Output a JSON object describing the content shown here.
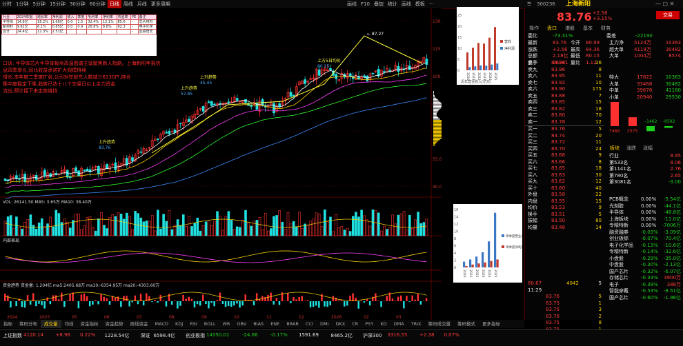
{
  "toolbar": {
    "timeframes": [
      "分时",
      "1分钟",
      "5分钟",
      "15分钟",
      "30分钟",
      "60分钟",
      "日线",
      "周线",
      "月线",
      "更多周期"
    ],
    "active_index": 6,
    "tools": [
      "画线",
      "F10",
      "叠加",
      "统计",
      "画线",
      "模板",
      "···"
    ]
  },
  "stock": {
    "code": "300236",
    "name": "上海新阳",
    "price": "83.76",
    "change": "+2.56",
    "pct": "+3.15%",
    "trade_btn": "交易"
  },
  "chart": {
    "ma_header": "MA5 MA10 MA20 MA60 ...",
    "price_labels": [
      "130.00",
      "115.00",
      "100.00",
      "85.00",
      "70.00",
      "55.00",
      "40.00"
    ],
    "peak_label": "87.27",
    "date_labels": [
      "2024",
      "2025",
      "05",
      "06",
      "07",
      "08",
      "09",
      "10",
      "11",
      "12",
      "2026",
      "02",
      "03"
    ],
    "vol_header": "VOL: 26141.50  MA5: 3.65万  MA10: 38.40万",
    "macd_header": "内部表现",
    "fund_header": "资金趋势  资金量: 1.204亿  ma5:2405.68万  ma10:-6354.95万  ma20:-4303.60万",
    "annotations": [
      "口诀: 半导体芯片半导体板块高温图谱主营聚焦新人指路。上海新阳年报信息四季增长,同比收益承诺扩大规模持续",
      "增长,本年度二季度扩张,公司对在股东人数减少6130户,持仓",
      "集中度稳定下降,趋势已达十八个交易日以上主力资金",
      "流出,预计接下来走势维持"
    ],
    "text_notes": [
      "上升趋势",
      "83.76",
      "上升趋势",
      "57.85",
      "上升趋势",
      "45.45",
      "上方5日均价",
      "80.15"
    ]
  },
  "info_table": {
    "rows": [
      [
        "行业",
        "2024年报",
        "增长率",
        "净利润",
        "收入",
        "季度",
        "毛利率",
        "净利率",
        "市盈率",
        "PE",
        "备注"
      ],
      [
        "半导体",
        "14.8亿",
        "18.2%",
        "1.66亿",
        "0.0",
        "1.5",
        "32.4%",
        "12.1%",
        "85.6",
        "-",
        "芯片材料"
      ],
      [
        "新材料",
        "9.62亿",
        "6.1%",
        "0.85亿",
        "0.0",
        "0.9",
        "28.8%",
        "8.8%",
        "62.3",
        "-",
        "电子化学"
      ],
      [
        "合计",
        "24.4亿",
        "12.3%",
        "2.51亿",
        "",
        "",
        "",
        "",
        "",
        "-",
        "业绩增长"
      ]
    ]
  },
  "mini_chart1": {
    "title": "近年营业收入(亿元)",
    "years": [
      "2020",
      "2021",
      "2022",
      "2023",
      "2024",
      "2025"
    ],
    "series": [
      {
        "name": "营收",
        "color": "#c0392b",
        "values": [
          8.1,
          10.2,
          12.4,
          12.1,
          14.8,
          19.6
        ]
      },
      {
        "name": "净利润",
        "color": "#3a78c3",
        "values": [
          1.5,
          1.8,
          2.2,
          2.1,
          2.6,
          3.1
        ]
      }
    ],
    "yticks": [
      "25",
      "20",
      "15",
      "10",
      "5",
      "0"
    ]
  },
  "mini_chart2": {
    "years": [
      "2020",
      "2021",
      "2022",
      "2023",
      "2024",
      "2025"
    ],
    "series": [
      {
        "name": "单季度营业收入(亿元)",
        "color": "#3a78c3",
        "values": [
          1.6,
          2.2,
          3.0,
          4.2,
          7.2,
          15.1
        ]
      },
      {
        "name": "单季度净利润(万元)",
        "color": "#c0392b",
        "values": [
          0.4,
          0.8,
          1.1,
          1.4,
          1.8,
          2.2
        ]
      }
    ],
    "yticks": [
      "16",
      "14",
      "12",
      "10",
      "8",
      "6",
      "4",
      "2",
      "0"
    ]
  },
  "right_panel": {
    "tabs": [
      "操作",
      "盘口",
      "港股",
      "基本",
      "财务"
    ],
    "header_row": [
      "委比",
      "-73.31%",
      "委差",
      "-22190"
    ],
    "summary": [
      {
        "l": "最新",
        "v": "83.76",
        "l2": "今开",
        "v2": "80.99"
      },
      {
        "l": "涨跌",
        "v": "+2.56",
        "l2": "最高",
        "v2": "84.36"
      },
      {
        "l": "总额",
        "v": "2.18亿",
        "l2": "最低",
        "v2": "80.15"
      },
      {
        "l": "总手",
        "v": "26241",
        "l2": "量比",
        "v2": "1.12"
      }
    ],
    "order_book": [
      {
        "l": "卖十",
        "p": "83.98",
        "q": "26"
      },
      {
        "l": "卖九",
        "p": "83.96",
        "q": "8"
      },
      {
        "l": "卖八",
        "p": "83.95",
        "q": "11"
      },
      {
        "l": "卖七",
        "p": "83.92",
        "q": "10"
      },
      {
        "l": "卖六",
        "p": "83.90",
        "q": "175"
      },
      {
        "l": "卖五",
        "p": "83.88",
        "q": "7"
      },
      {
        "l": "卖四",
        "p": "83.85",
        "q": "15"
      },
      {
        "l": "卖三",
        "p": "83.82",
        "q": "18"
      },
      {
        "l": "卖二",
        "p": "83.80",
        "q": "70"
      },
      {
        "l": "卖一",
        "p": "83.78",
        "q": "12"
      },
      {
        "l": "买一",
        "p": "83.76",
        "q": "5"
      },
      {
        "l": "买二",
        "p": "83.74",
        "q": "20"
      },
      {
        "l": "买三",
        "p": "83.72",
        "q": "11"
      },
      {
        "l": "买四",
        "p": "83.70",
        "q": "24"
      },
      {
        "l": "买五",
        "p": "83.68",
        "q": "9"
      },
      {
        "l": "买六",
        "p": "83.66",
        "q": "8"
      },
      {
        "l": "买七",
        "p": "83.65",
        "q": "18"
      },
      {
        "l": "买八",
        "p": "83.63",
        "q": "30"
      },
      {
        "l": "买九",
        "p": "83.62",
        "q": "12"
      },
      {
        "l": "买十",
        "p": "83.60",
        "q": "40"
      },
      {
        "l": "外盘",
        "p": "83.58",
        "q": "22"
      },
      {
        "l": "内盘",
        "p": "83.55",
        "q": "15"
      },
      {
        "l": "均价",
        "p": "83.53",
        "q": "9"
      },
      {
        "l": "换手",
        "p": "83.51",
        "q": "5"
      },
      {
        "l": "振幅",
        "p": "83.50",
        "q": "80"
      },
      {
        "l": "均量",
        "p": "83.48",
        "q": "14"
      }
    ],
    "fund_flow": [
      {
        "l": "主力净",
        "v": "5124万",
        "v2": "10363"
      },
      {
        "l": "超大单",
        "v": "4119万",
        "v2": "30482"
      },
      {
        "l": "大单",
        "v": "1004万",
        "v2": "8574"
      }
    ],
    "flow_table": [
      {
        "l": "特大",
        "a": "17822",
        "b": "10363"
      },
      {
        "l": "大单",
        "a": "33468",
        "b": "30482"
      },
      {
        "l": "中单",
        "a": "39678",
        "b": "41180"
      },
      {
        "l": "小单",
        "a": "20940",
        "b": "29530"
      }
    ],
    "bar_values": [
      {
        "v": "7469",
        "c": "red"
      },
      {
        "v": "2575",
        "c": "red"
      },
      {
        "v": "-1462",
        "c": "grn"
      },
      {
        "v": "-0502",
        "c": "grn"
      }
    ],
    "sector_tabs": [
      "板块",
      "涨跌",
      "涨幅"
    ],
    "rank_rows": [
      {
        "n": "行业",
        "v": "8.95"
      },
      {
        "n": "第533名",
        "v": "8.06"
      },
      {
        "n": "第1141名",
        "v": "2.76"
      },
      {
        "n": "第780名",
        "v": "2.65"
      },
      {
        "n": "第3081名",
        "v": "-3.00"
      }
    ],
    "concept_rows": [
      {
        "n": "PCB概念",
        "a": "0.00%",
        "b": "-5.54亿"
      },
      {
        "n": "光刻胶",
        "a": "0.00%",
        "b": "-44.1亿"
      },
      {
        "n": "半导体",
        "a": "0.00%",
        "b": "-48.8亿"
      },
      {
        "n": "上海板块",
        "a": "0.00%",
        "b": "-11.0亿"
      },
      {
        "n": "专精特新",
        "a": "0.00%",
        "b": "-7006万"
      },
      {
        "n": "融资融券",
        "a": "-0.03%",
        "b": "-3.09亿"
      },
      {
        "n": "创业板综",
        "a": "-0.07%",
        "b": "-70.4亿"
      },
      {
        "n": "电子化学品",
        "a": "-0.13%",
        "b": "-10.6亿"
      },
      {
        "n": "专精特新",
        "a": "-0.14%",
        "b": "-32.6亿"
      },
      {
        "n": "小盘股",
        "a": "-0.29%",
        "b": "-35.0亿"
      },
      {
        "n": "中盘股",
        "a": "-0.30%",
        "b": "-2.13亿"
      },
      {
        "n": "国产芯片",
        "a": "-0.32%",
        "b": "-6.07亿"
      },
      {
        "n": "存储芯片",
        "a": "-0.33%",
        "b": "3900万"
      },
      {
        "n": "电子",
        "a": "-0.39%",
        "b": "388万"
      },
      {
        "n": "智能穿戴",
        "a": "-0.53%",
        "b": "-8.51亿"
      },
      {
        "n": "国产芯片",
        "a": "-0.60%",
        "b": "-1.96亿"
      }
    ],
    "tick_time": "11:29",
    "ticks": [
      {
        "p": "83.76",
        "q": "5"
      },
      {
        "p": "83.75",
        "q": "1"
      },
      {
        "p": "83.75",
        "q": "3"
      },
      {
        "p": "83.76",
        "q": "2"
      },
      {
        "p": "83.75",
        "q": "8"
      },
      {
        "p": "83.75",
        "q": "1"
      },
      {
        "p": "83.75",
        "q": "4"
      },
      {
        "p": "83.75",
        "q": "2"
      }
    ],
    "total_row": {
      "p": "80.67",
      "q": "4042",
      "x": "5"
    }
  },
  "indicator_tabs": [
    "指标",
    "筹码分布",
    "成交量",
    "均线",
    "资金指标",
    "资金趋势",
    "周线资金",
    "MACD",
    "KDJ",
    "RSI",
    "BOLL",
    "WR",
    "OBV",
    "BIAS",
    "ENE",
    "BRAR",
    "CCI",
    "DMI",
    "DKX",
    "CR",
    "PSY",
    "KD",
    "DMA",
    "TRIX",
    "筹码成交量",
    "筹码模式",
    "更多指标"
  ],
  "indicator_active": 2,
  "status_bar": {
    "items": [
      {
        "t": "上证指数",
        "c": "wht"
      },
      {
        "t": "4120.14",
        "c": "red"
      },
      {
        "t": "+8.96",
        "c": "red"
      },
      {
        "t": "0.22%",
        "c": "red"
      },
      {
        "t": "1228.54亿",
        "c": "wht"
      },
      {
        "t": "深证",
        "c": "wht"
      },
      {
        "t": "6598.4亿",
        "c": "wht"
      },
      {
        "t": "创业板指",
        "c": "wht"
      },
      {
        "t": "14350.01",
        "c": "grn"
      },
      {
        "t": "-24.66",
        "c": "grn"
      },
      {
        "t": "-0.17%",
        "c": "grn"
      },
      {
        "t": "1591.69",
        "c": "wht"
      },
      {
        "t": "8465.2亿",
        "c": "wht"
      },
      {
        "t": "沪深300",
        "c": "wht"
      },
      {
        "t": "3316.55",
        "c": "red"
      },
      {
        "t": "+2.38",
        "c": "red"
      },
      {
        "t": "0.07%",
        "c": "red"
      }
    ]
  }
}
